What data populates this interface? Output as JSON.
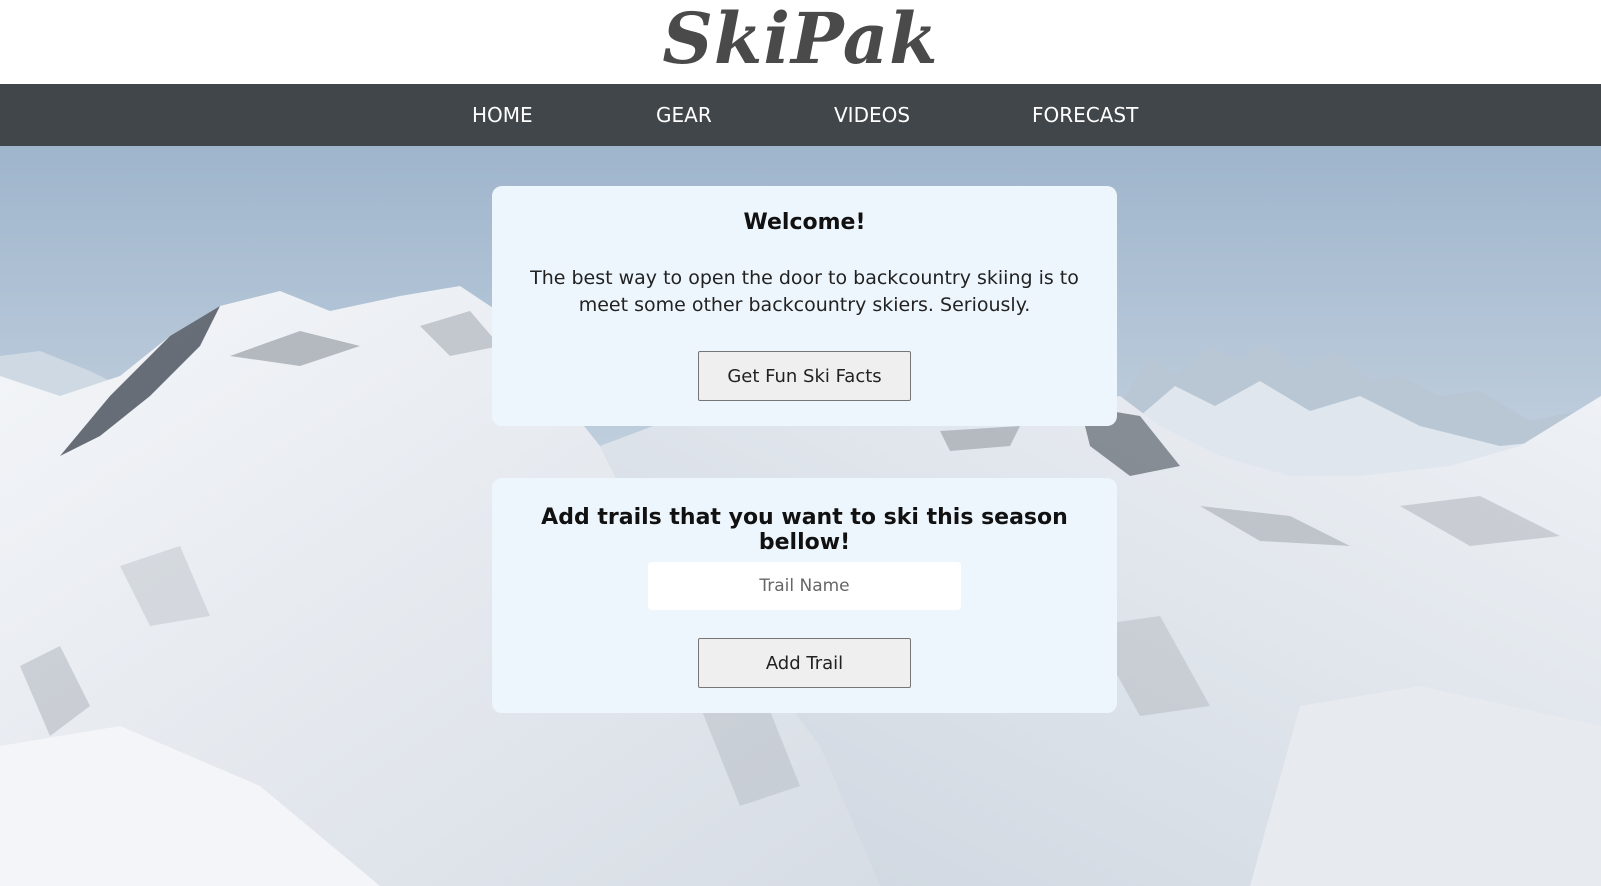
{
  "brand": {
    "logo_text": "SkiPak"
  },
  "nav": {
    "items": [
      {
        "label": "HOME"
      },
      {
        "label": "GEAR"
      },
      {
        "label": "VIDEOS"
      },
      {
        "label": "FORECAST"
      }
    ]
  },
  "welcome": {
    "heading": "Welcome!",
    "body": "The best way to open the door to backcountry skiing is to meet some other backcountry skiers. Seriously.",
    "button_label": "Get Fun Ski Facts"
  },
  "trails": {
    "heading": "Add trails that you want to ski this season bellow!",
    "input_placeholder": "Trail Name",
    "input_value": "",
    "button_label": "Add Trail"
  },
  "colors": {
    "navbar": "#41464b",
    "card_background": "#eef6fd",
    "logo": "#4a4a4a"
  }
}
